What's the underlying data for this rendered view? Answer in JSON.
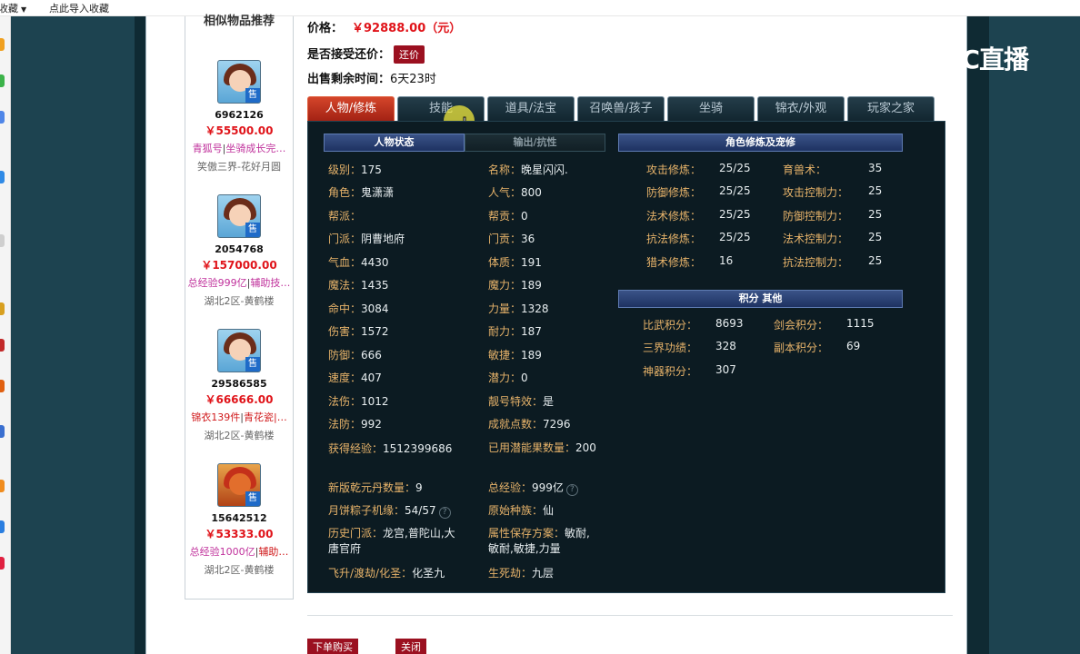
{
  "bookmarks": {
    "item1": "收藏",
    "item2": "点此导入收藏"
  },
  "watermark": {
    "text": "CC直播"
  },
  "similar": {
    "title": "相似物品推荐",
    "items": [
      {
        "id": "6962126",
        "price": "￥55500.00",
        "desc_a": "青狐号",
        "desc_b": "坐骑成长完…",
        "server": "笑傲三界-花好月圆",
        "tag": "售",
        "desc_a_color": "pink",
        "desc_b_color": "pink"
      },
      {
        "id": "2054768",
        "price": "￥157000.00",
        "desc_a": "总经验999亿",
        "desc_b": "辅助技…",
        "server": "湖北2区-黄鹤楼",
        "tag": "售",
        "desc_a_color": "pink",
        "desc_b_color": "pink"
      },
      {
        "id": "29586585",
        "price": "￥66666.00",
        "desc_a": "锦衣139件",
        "desc_b": "青花瓷|…",
        "server": "湖北2区-黄鹤楼",
        "tag": "售",
        "desc_a_color": "red",
        "desc_b_color": "red"
      },
      {
        "id": "15642512",
        "price": "￥53333.00",
        "desc_a": "总经验1000亿",
        "desc_b": "辅助…",
        "server": "湖北2区-黄鹤楼",
        "tag": "售",
        "desc_a_color": "pink",
        "desc_b_color": "red"
      }
    ]
  },
  "price": {
    "label": "价格：",
    "value": "￥92888.00（元）"
  },
  "bargain": {
    "label": "是否接受还价：",
    "button": "还价"
  },
  "remaining": {
    "label": "出售剩余时间：",
    "value": "6天23时"
  },
  "tabs": [
    "人物/修炼",
    "技能",
    "道具/法宝",
    "召唤兽/孩子",
    "坐骑",
    "锦衣/外观",
    "玩家之家"
  ],
  "sections": {
    "status": "人物状态",
    "resist": "输出/抗性",
    "cultivation": "角色修炼及宠修",
    "points": "积分 其他"
  },
  "stats_left": [
    {
      "k": "级别：",
      "v": "175"
    },
    {
      "k": "角色：",
      "v": "鬼潇潇"
    },
    {
      "k": "帮派：",
      "v": ""
    },
    {
      "k": "门派：",
      "v": "阴曹地府"
    },
    {
      "k": "气血：",
      "v": "4430"
    },
    {
      "k": "魔法：",
      "v": "1435"
    },
    {
      "k": "命中：",
      "v": "3084"
    },
    {
      "k": "伤害：",
      "v": "1572"
    },
    {
      "k": "防御：",
      "v": "666"
    },
    {
      "k": "速度：",
      "v": "407"
    },
    {
      "k": "法伤：",
      "v": "1012"
    },
    {
      "k": "法防：",
      "v": "992"
    },
    {
      "k": "获得经验：",
      "v": "1512399686"
    },
    {
      "k": "新版乾元丹数量：",
      "v": "9"
    },
    {
      "k": "月饼粽子机缘：",
      "v": "54/57"
    },
    {
      "k": "历史门派：",
      "v": "龙宫,普陀山,大唐官府"
    },
    {
      "k": "飞升/渡劫/化圣：",
      "v": "化圣九"
    }
  ],
  "stats_mid": [
    {
      "k": "名称：",
      "v": "晚星闪闪."
    },
    {
      "k": "人气：",
      "v": "800"
    },
    {
      "k": "帮贡：",
      "v": "0"
    },
    {
      "k": "门贡：",
      "v": "36"
    },
    {
      "k": "体质：",
      "v": "191"
    },
    {
      "k": "魔力：",
      "v": "189"
    },
    {
      "k": "力量：",
      "v": "1328"
    },
    {
      "k": "耐力：",
      "v": "187"
    },
    {
      "k": "敏捷：",
      "v": "189"
    },
    {
      "k": "潜力：",
      "v": "0"
    },
    {
      "k": "靓号特效：",
      "v": "是"
    },
    {
      "k": "成就点数：",
      "v": "7296"
    },
    {
      "k": "已用潜能果数量：",
      "v": "200"
    },
    {
      "k": "总经验：",
      "v": "999亿"
    },
    {
      "k": "原始种族：",
      "v": "仙"
    },
    {
      "k": "属性保存方案：",
      "v": "敏耐,敏耐,敏捷,力量"
    },
    {
      "k": "生死劫：",
      "v": "九层"
    }
  ],
  "cultivation_left": [
    {
      "k": "攻击修炼：",
      "v": "25/25"
    },
    {
      "k": "防御修炼：",
      "v": "25/25"
    },
    {
      "k": "法术修炼：",
      "v": "25/25"
    },
    {
      "k": "抗法修炼：",
      "v": "25/25"
    },
    {
      "k": "猎术修炼：",
      "v": "16"
    }
  ],
  "cultivation_right": [
    {
      "k": "育兽术：",
      "v": "35"
    },
    {
      "k": "攻击控制力：",
      "v": "25"
    },
    {
      "k": "防御控制力：",
      "v": "25"
    },
    {
      "k": "法术控制力：",
      "v": "25"
    },
    {
      "k": "抗法控制力：",
      "v": "25"
    }
  ],
  "points_left": [
    {
      "k": "比武积分：",
      "v": "8693"
    },
    {
      "k": "三界功绩：",
      "v": "328"
    },
    {
      "k": "神器积分：",
      "v": "307"
    }
  ],
  "points_right": [
    {
      "k": "剑会积分：",
      "v": "1115"
    },
    {
      "k": "副本积分：",
      "v": "69"
    }
  ],
  "help_glyph": "?",
  "buttons": {
    "buy": "下单购买",
    "close": "关闭"
  }
}
